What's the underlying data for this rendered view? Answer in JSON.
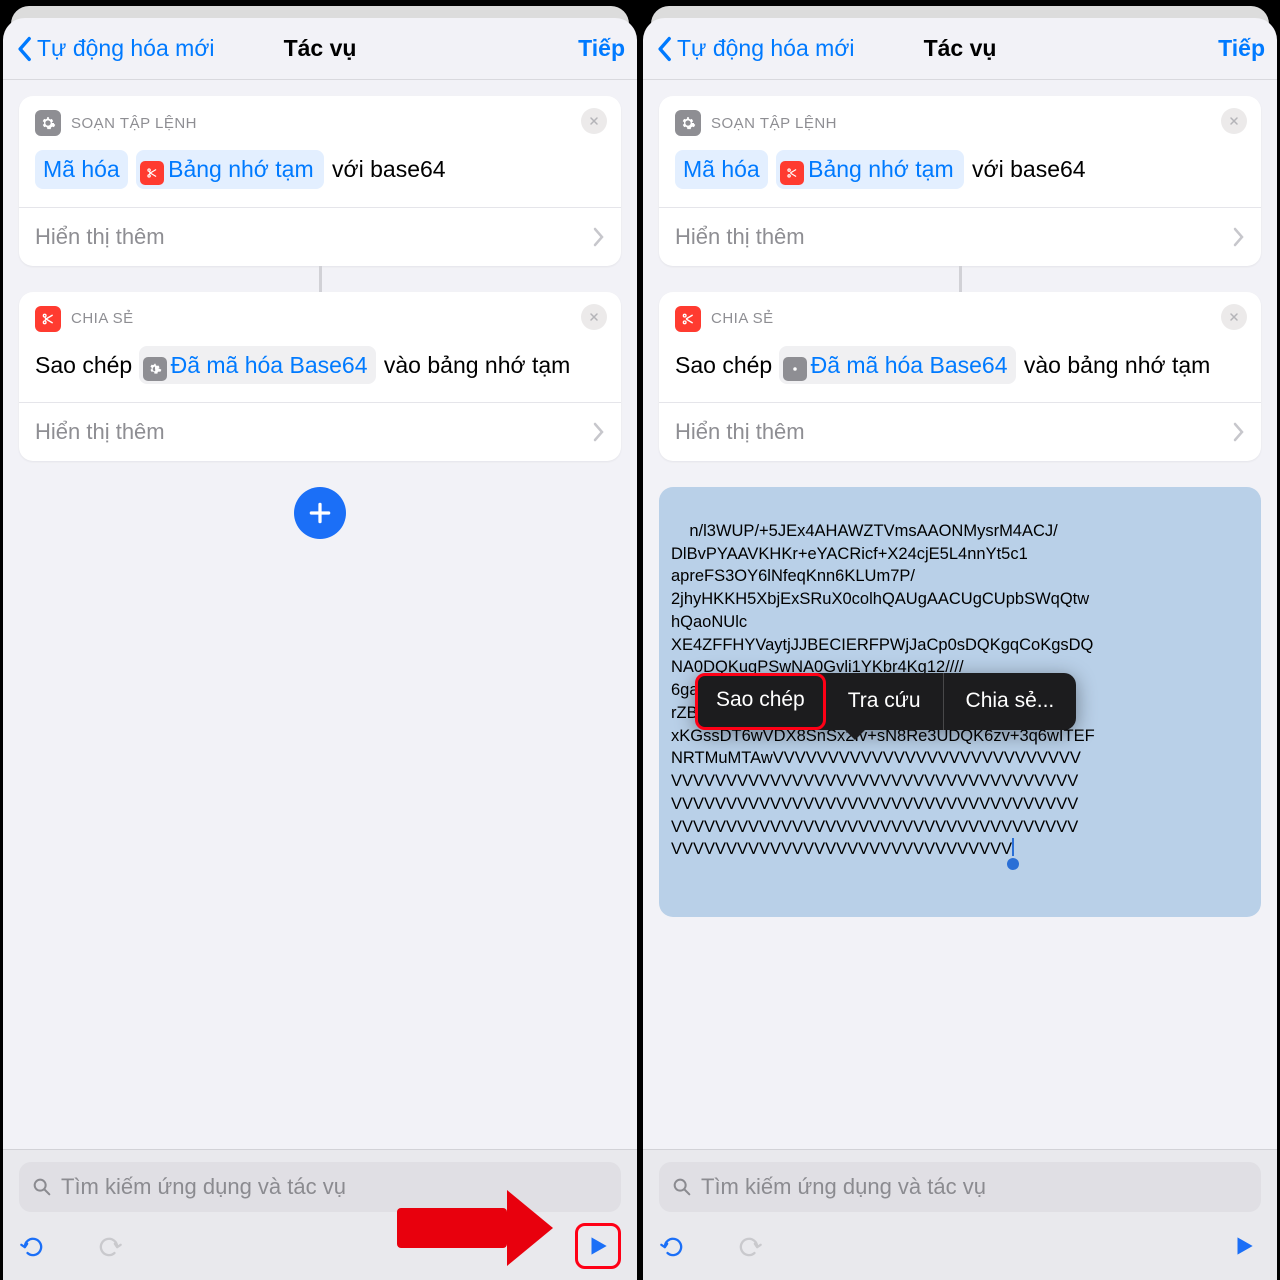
{
  "nav": {
    "back": "Tự động hóa mới",
    "title": "Tác vụ",
    "next": "Tiếp"
  },
  "card1": {
    "header": "SOẠN TẬP LỆNH",
    "action": "Mã hóa",
    "clip": "Bảng nhớ tạm",
    "tail1": "với",
    "tail2": "base64",
    "more": "Hiển thị thêm"
  },
  "card2": {
    "header": "CHIA SẺ",
    "pre": "Sao chép",
    "var": "Đã mã hóa Base64",
    "tail1": "vào",
    "tail2": "bảng nhớ tạm",
    "more": "Hiển thị thêm"
  },
  "output": "n/l3WUP/+5JEx4AHAWZTVmsAAONMysrM4ACJ/\nDlBvPYAAVKHKr+eYACRicf+X24cjE5L4nnYt5c1\napreFS3OY6lNfeqKnn6KLUm7P/\n2jhyHKKH5XbjExSRuX0colhQAUgAACUgCUpbSWqQtw\nhQaoNUlc\nXE4ZFFHYVaytjJJBECIERFPWjJaCp0sDQKgqCoKgsDQ\nNA0DQKugPSwNA0Gvli1YKbr4Kg12////\n6gaQS                                                 00VC9\nrZBSJE\nxKGssDT6wVDX8SnSx2Iv+sN8Re3UDQK6zv+3q6wITEF\nNRTMuMTAwVVVVVVVVVVVVVVVVVVVVVVVVVVVV\nVVVVVVVVVVVVVVVVVVVVVVVVVVVVVVVVVVVVV\nVVVVVVVVVVVVVVVVVVVVVVVVVVVVVVVVVVVVV\nVVVVVVVVVVVVVVVVVVVVVVVVVVVVVVVVVVVVV\nVVVVVVVVVVVVVVVVVVVVVVVVVVVVVVV",
  "popover": {
    "copy": "Sao chép",
    "lookup": "Tra cứu",
    "share": "Chia sẻ..."
  },
  "search": {
    "placeholder": "Tìm kiếm ứng dụng và tác vụ"
  }
}
